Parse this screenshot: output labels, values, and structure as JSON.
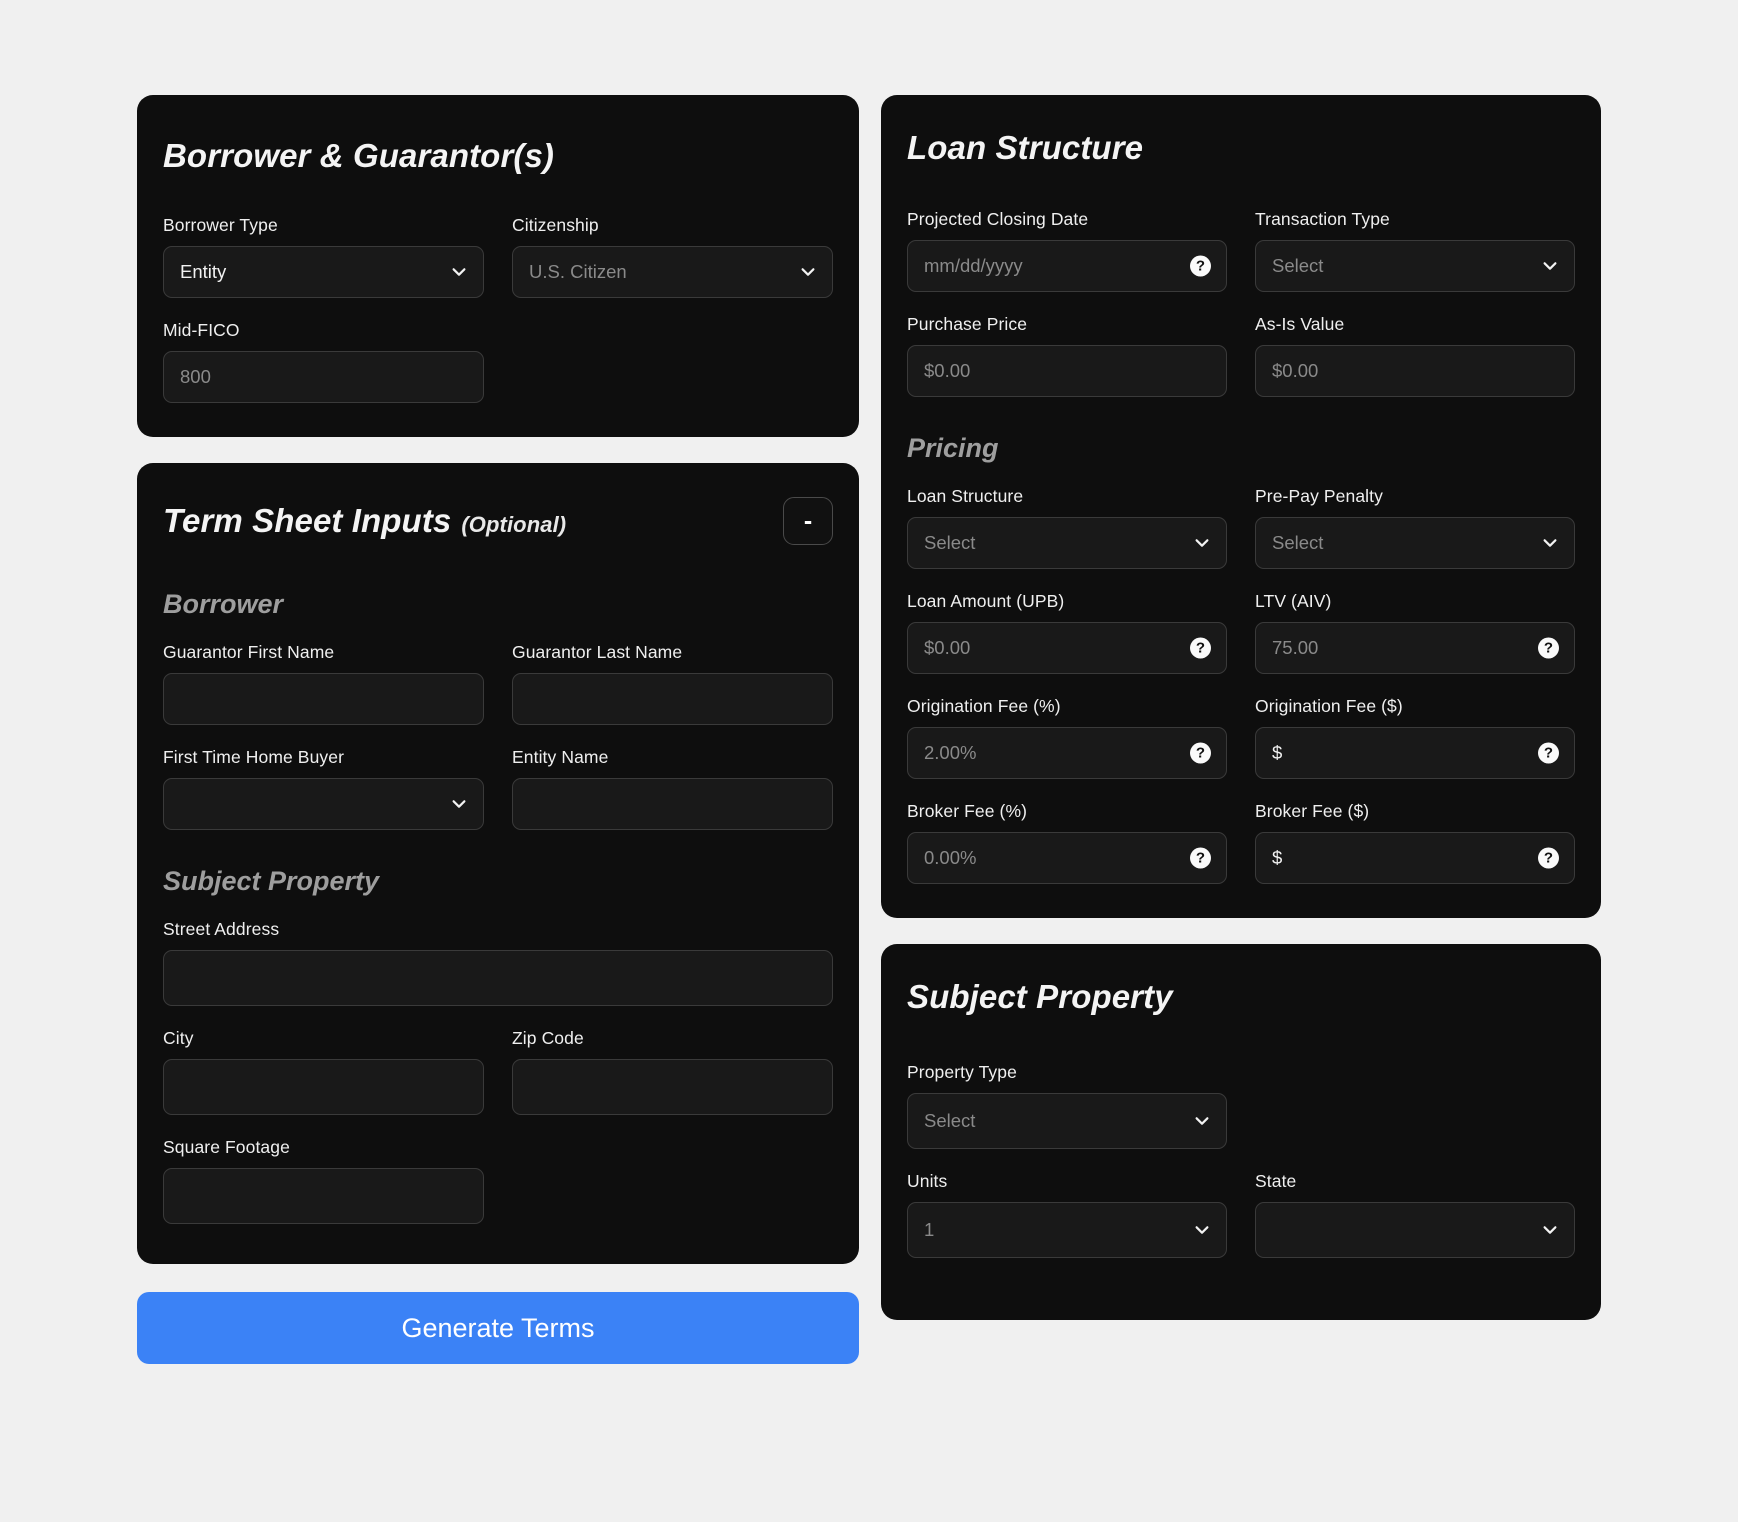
{
  "borrower_card": {
    "title": "Borrower & Guarantor(s)",
    "fields": {
      "borrower_type": {
        "label": "Borrower Type",
        "value": "Entity"
      },
      "citizenship": {
        "label": "Citizenship",
        "placeholder": "U.S. Citizen"
      },
      "mid_fico": {
        "label": "Mid-FICO",
        "placeholder": "800"
      }
    }
  },
  "term_sheet_card": {
    "title": "Term Sheet Inputs",
    "optional": "(Optional)",
    "collapse_label": "-",
    "borrower_section": {
      "heading": "Borrower",
      "guarantor_first_name": {
        "label": "Guarantor First Name",
        "value": ""
      },
      "guarantor_last_name": {
        "label": "Guarantor Last Name",
        "value": ""
      },
      "first_time_home_buyer": {
        "label": "First Time Home Buyer",
        "value": ""
      },
      "entity_name": {
        "label": "Entity Name",
        "value": ""
      }
    },
    "subject_property_section": {
      "heading": "Subject Property",
      "street_address": {
        "label": "Street Address",
        "value": ""
      },
      "city": {
        "label": "City",
        "value": ""
      },
      "zip_code": {
        "label": "Zip Code",
        "value": ""
      },
      "square_footage": {
        "label": "Square Footage",
        "value": ""
      }
    }
  },
  "generate_button": {
    "label": "Generate Terms"
  },
  "loan_structure_card": {
    "title": "Loan Structure",
    "projected_closing_date": {
      "label": "Projected Closing Date",
      "placeholder": "mm/dd/yyyy",
      "help": "?"
    },
    "transaction_type": {
      "label": "Transaction Type",
      "placeholder": "Select"
    },
    "purchase_price": {
      "label": "Purchase Price",
      "placeholder": "$0.00"
    },
    "as_is_value": {
      "label": "As-Is Value",
      "placeholder": "$0.00"
    },
    "pricing": {
      "heading": "Pricing",
      "loan_structure": {
        "label": "Loan Structure",
        "placeholder": "Select"
      },
      "pre_pay_penalty": {
        "label": "Pre-Pay Penalty",
        "placeholder": "Select"
      },
      "loan_amount_upb": {
        "label": "Loan Amount (UPB)",
        "placeholder": "$0.00",
        "help": "?"
      },
      "ltv_aiv": {
        "label": "LTV (AIV)",
        "placeholder": "75.00",
        "help": "?"
      },
      "origination_fee_pct": {
        "label": "Origination Fee (%)",
        "placeholder": "2.00%",
        "help": "?"
      },
      "origination_fee_dollar": {
        "label": "Origination Fee ($)",
        "value": "$",
        "help": "?"
      },
      "broker_fee_pct": {
        "label": "Broker Fee (%)",
        "placeholder": "0.00%",
        "help": "?"
      },
      "broker_fee_dollar": {
        "label": "Broker Fee ($)",
        "value": "$",
        "help": "?"
      }
    }
  },
  "subject_property_card": {
    "title": "Subject Property",
    "property_type": {
      "label": "Property Type",
      "placeholder": "Select"
    },
    "units": {
      "label": "Units",
      "placeholder": "1"
    },
    "state": {
      "label": "State",
      "placeholder": ""
    }
  },
  "colors": {
    "accent": "#3b82f6",
    "card_bg": "#0e0e0e",
    "input_bg": "#191919",
    "page_bg": "#f0f0f0"
  }
}
